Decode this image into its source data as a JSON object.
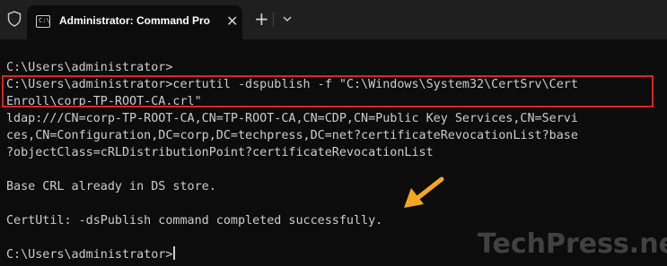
{
  "window": {
    "tab_title": "Administrator: Command Pro",
    "tab_icon_text": "C:\\",
    "close_glyph": "✕",
    "new_tab_glyph": "+"
  },
  "terminal": {
    "line1": "C:\\Users\\administrator>",
    "line2": "C:\\Users\\administrator>certutil -dspublish -f \"C:\\Windows\\System32\\CertSrv\\Cert",
    "line3": "Enroll\\corp-TP-ROOT-CA.crl\"",
    "line4": "ldap:///CN=corp-TP-ROOT-CA,CN=TP-ROOT-CA,CN=CDP,CN=Public Key Services,CN=Servi",
    "line5": "ces,CN=Configuration,DC=corp,DC=techpress,DC=net?certificateRevocationList?base",
    "line6": "?objectClass=cRLDistributionPoint?certificateRevocationList",
    "line7": "Base CRL already in DS store.",
    "line8": "CertUtil: -dsPublish command completed successfully.",
    "line9": "C:\\Users\\administrator>"
  },
  "watermark": "TechPress.net",
  "colors": {
    "background": "#0c0c0c",
    "titlebar": "#1f1f1f",
    "text": "#cccccc",
    "highlight_border": "#e02020",
    "arrow": "#f5a623"
  },
  "icons": [
    "shield-icon",
    "terminal-icon",
    "close-icon",
    "plus-icon",
    "chevron-down-icon",
    "arrow-icon"
  ]
}
